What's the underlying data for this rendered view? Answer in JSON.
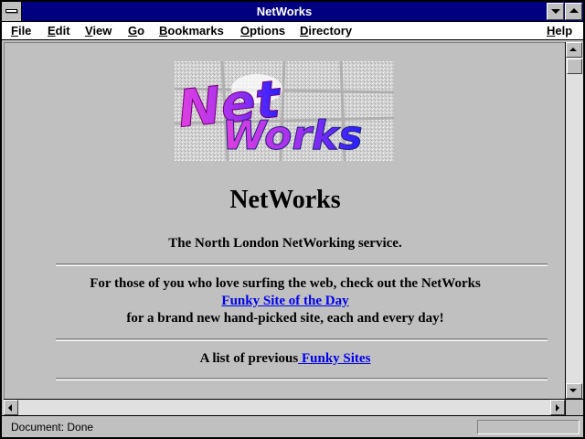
{
  "window": {
    "title": "NetWorks"
  },
  "menubar": {
    "items": [
      {
        "label": "File"
      },
      {
        "label": "Edit"
      },
      {
        "label": "View"
      },
      {
        "label": "Go"
      },
      {
        "label": "Bookmarks"
      },
      {
        "label": "Options"
      },
      {
        "label": "Directory"
      }
    ],
    "help": "Help"
  },
  "page": {
    "logo_text": "NetWorks",
    "heading": "NetWorks",
    "tagline": "The North London NetWorking service.",
    "intro_line1": "For those of you who love surfing the web, check out the NetWorks",
    "funky_link": "Funky Site of the Day",
    "intro_line3": "for a brand new hand-picked site, each and every day!",
    "previous_prefix": "A list of previous",
    "previous_link": " Funky Sites"
  },
  "status": {
    "text": "Document: Done"
  },
  "colors": {
    "titlebar": "#000080",
    "link": "#0000ee",
    "face": "#c0c0c0"
  }
}
